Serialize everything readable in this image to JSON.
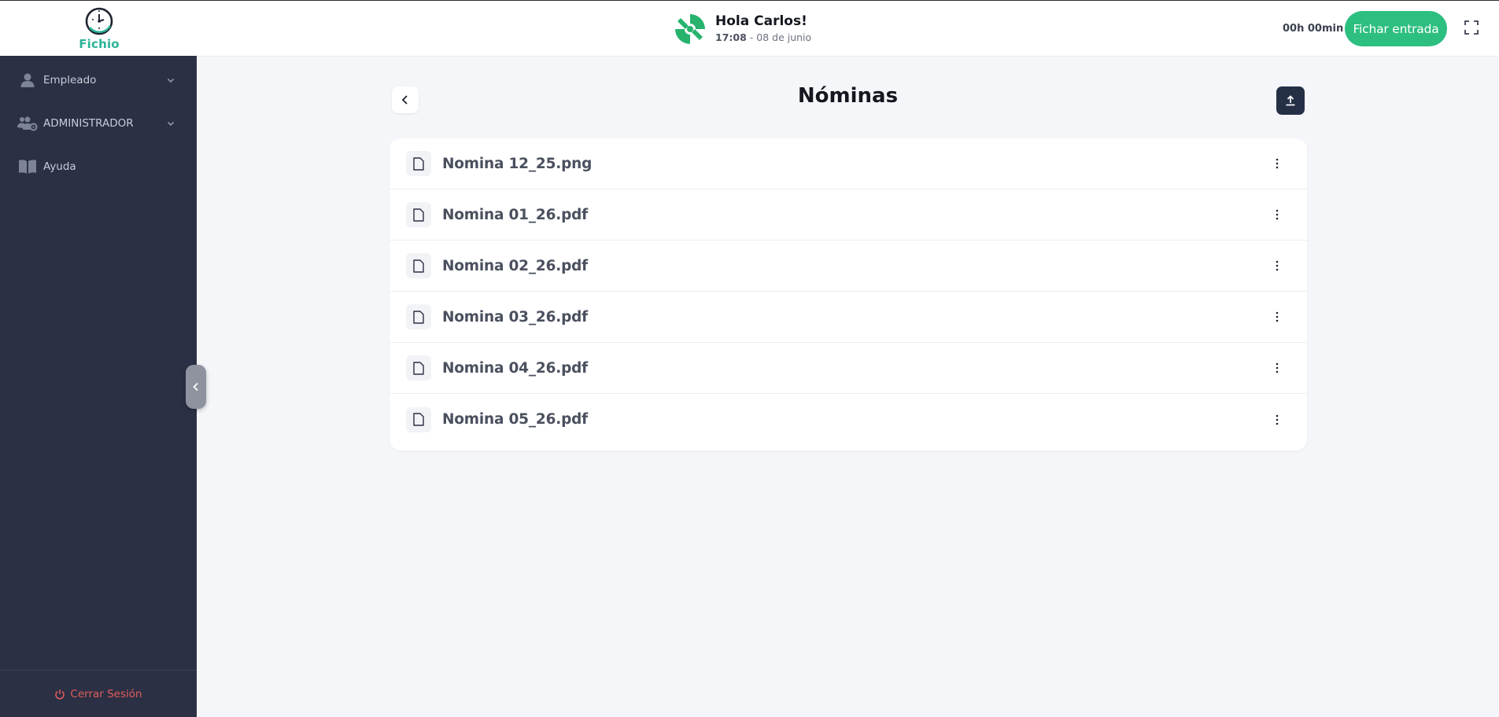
{
  "app": {
    "logo_text": "Fichio",
    "accent_color": "#2dbf80",
    "logo_color": "#2bb397"
  },
  "header": {
    "greeting": "Hola Carlos!",
    "time": "17:08",
    "separator": " - ",
    "date": "08 de junio",
    "timer": "00h 00min",
    "clockin_label": "Fichar entrada",
    "fullscreen_icon": "fullscreen-icon"
  },
  "sidebar": {
    "items": [
      {
        "label": "Empleado",
        "icon": "user-icon",
        "has_chevron": true
      },
      {
        "label": "ADMINISTRADOR",
        "icon": "users-gear-icon",
        "has_chevron": true
      },
      {
        "label": "Ayuda",
        "icon": "book-icon",
        "has_chevron": false
      }
    ],
    "logout_label": "Cerrar Sesión"
  },
  "main": {
    "title": "Nóminas",
    "files": [
      {
        "name": "Nomina 12_25.png"
      },
      {
        "name": "Nomina 01_26.pdf"
      },
      {
        "name": "Nomina 02_26.pdf"
      },
      {
        "name": "Nomina 03_26.pdf"
      },
      {
        "name": "Nomina 04_26.pdf"
      },
      {
        "name": "Nomina 05_26.pdf"
      }
    ]
  }
}
